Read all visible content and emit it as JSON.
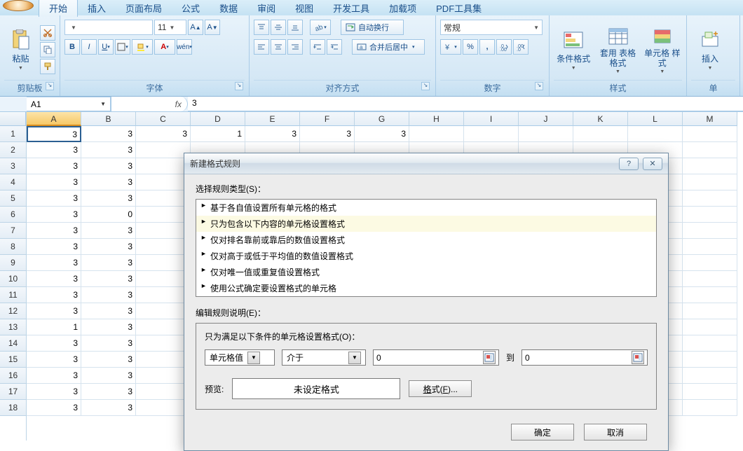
{
  "tabs": {
    "items": [
      "开始",
      "插入",
      "页面布局",
      "公式",
      "数据",
      "审阅",
      "视图",
      "开发工具",
      "加载项",
      "PDF工具集"
    ],
    "active": "开始"
  },
  "ribbon": {
    "clipboard": {
      "paste": "粘贴",
      "label": "剪贴板"
    },
    "font": {
      "label": "字体",
      "size": "11",
      "bold": "B",
      "italic": "I",
      "underline": "U"
    },
    "alignment": {
      "label": "对齐方式",
      "wrap": "自动换行",
      "merge": "合并后居中"
    },
    "number": {
      "label": "数字",
      "format": "常规",
      "pct": "%",
      "comma": ",",
      "inc": "",
      "dec": ""
    },
    "styles": {
      "label": "样式",
      "cond": "条件格式",
      "tblfmt": "套用\n表格格式",
      "cellstyle": "单元格\n样式"
    },
    "cells": {
      "label": "单",
      "insert": "插入"
    }
  },
  "formula_bar": {
    "name": "A1",
    "fx": "fx",
    "value": "3"
  },
  "grid": {
    "cols": [
      "A",
      "B",
      "C",
      "D",
      "E",
      "F",
      "G",
      "H",
      "I",
      "J",
      "K",
      "L",
      "M"
    ],
    "rows": 18,
    "data": [
      [
        "3",
        "3",
        "3",
        "1",
        "3",
        "3",
        "3",
        "",
        "",
        "",
        "",
        "",
        ""
      ],
      [
        "3",
        "3",
        "",
        "",
        "",
        "",
        "",
        "",
        "",
        "",
        "",
        "",
        ""
      ],
      [
        "3",
        "3",
        "",
        "",
        "",
        "",
        "",
        "",
        "",
        "",
        "",
        "",
        ""
      ],
      [
        "3",
        "3",
        "",
        "",
        "",
        "",
        "",
        "",
        "",
        "",
        "",
        "",
        ""
      ],
      [
        "3",
        "3",
        "",
        "",
        "",
        "",
        "",
        "",
        "",
        "",
        "",
        "",
        ""
      ],
      [
        "3",
        "0",
        "",
        "",
        "",
        "",
        "",
        "",
        "",
        "",
        "",
        "",
        ""
      ],
      [
        "3",
        "3",
        "",
        "",
        "",
        "",
        "",
        "",
        "",
        "",
        "",
        "",
        ""
      ],
      [
        "3",
        "3",
        "",
        "",
        "",
        "",
        "",
        "",
        "",
        "",
        "",
        "",
        ""
      ],
      [
        "3",
        "3",
        "",
        "",
        "",
        "",
        "",
        "",
        "",
        "",
        "",
        "",
        ""
      ],
      [
        "3",
        "3",
        "",
        "",
        "",
        "",
        "",
        "",
        "",
        "",
        "",
        "",
        ""
      ],
      [
        "3",
        "3",
        "",
        "",
        "",
        "",
        "",
        "",
        "",
        "",
        "",
        "",
        ""
      ],
      [
        "3",
        "3",
        "",
        "",
        "",
        "",
        "",
        "",
        "",
        "",
        "",
        "",
        ""
      ],
      [
        "1",
        "3",
        "",
        "",
        "",
        "",
        "",
        "",
        "",
        "",
        "",
        "",
        ""
      ],
      [
        "3",
        "3",
        "",
        "",
        "",
        "",
        "",
        "",
        "",
        "",
        "",
        "",
        ""
      ],
      [
        "3",
        "3",
        "",
        "",
        "",
        "",
        "",
        "",
        "",
        "",
        "",
        "",
        ""
      ],
      [
        "3",
        "3",
        "",
        "",
        "",
        "",
        "",
        "",
        "",
        "",
        "",
        "",
        ""
      ],
      [
        "3",
        "3",
        "",
        "",
        "",
        "",
        "",
        "",
        "",
        "",
        "",
        "",
        ""
      ],
      [
        "3",
        "3",
        "",
        "",
        "",
        "",
        "",
        "",
        "",
        "",
        "",
        "",
        ""
      ]
    ]
  },
  "dialog": {
    "title": "新建格式规则",
    "select_label": "选择规则类型(S)：",
    "rules": [
      "基于各自值设置所有单元格的格式",
      "只为包含以下内容的单元格设置格式",
      "仅对排名靠前或靠后的数值设置格式",
      "仅对高于或低于平均值的数值设置格式",
      "仅对唯一值或重复值设置格式",
      "使用公式确定要设置格式的单元格"
    ],
    "selected_rule_index": 1,
    "edit_label": "编辑规则说明(E)：",
    "panel_title": "只为满足以下条件的单元格设置格式(O)：",
    "combo1": "单元格值",
    "combo2": "介于",
    "val1": "0",
    "to": "到",
    "val2": "0",
    "preview_label": "预览:",
    "preview_text": "未设定格式",
    "format_btn": "格式(F)...",
    "ok": "确定",
    "cancel": "取消"
  }
}
